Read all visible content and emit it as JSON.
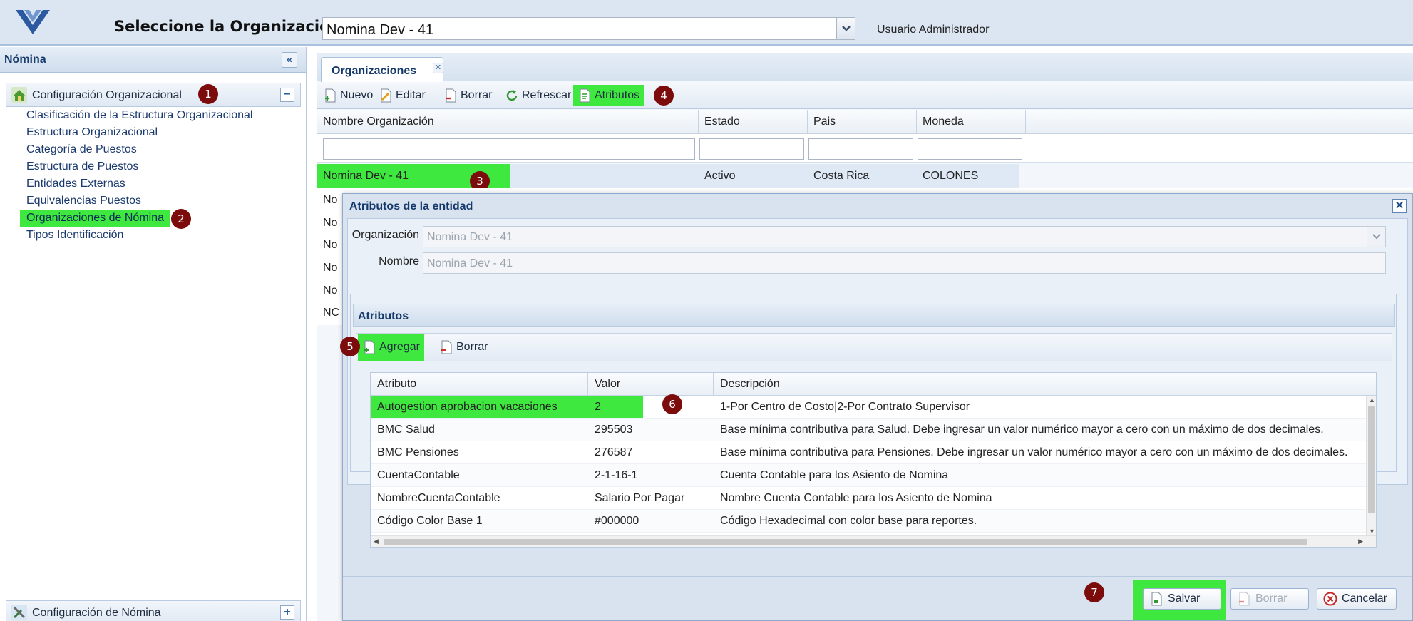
{
  "header": {
    "org_label": "Seleccione la Organización:",
    "org_value": "Nomina Dev - 41",
    "user": "Usuario Administrador"
  },
  "sidebar": {
    "title": "Nómina",
    "groups": [
      {
        "label": "Configuración Organizacional",
        "state": "−"
      },
      {
        "label": "Configuración de Nómina",
        "state": "+"
      }
    ],
    "items": [
      {
        "label": "Clasificación de la Estructura Organizacional"
      },
      {
        "label": "Estructura Organizacional"
      },
      {
        "label": "Categoría de Puestos"
      },
      {
        "label": "Estructura de Puestos"
      },
      {
        "label": "Entidades Externas"
      },
      {
        "label": "Equivalencias Puestos"
      },
      {
        "label": "Organizaciones de Nómina"
      },
      {
        "label": "Tipos Identificación"
      }
    ]
  },
  "markers": [
    "1",
    "2",
    "3",
    "4",
    "5",
    "6",
    "7"
  ],
  "tab": {
    "label": "Organizaciones"
  },
  "toolbar": {
    "nuevo": "Nuevo",
    "editar": "Editar",
    "borrar": "Borrar",
    "refrescar": "Refrescar",
    "atributos": "Atributos"
  },
  "grid": {
    "columns": [
      "Nombre Organización",
      "Estado",
      "Pais",
      "Moneda"
    ],
    "rows": [
      {
        "name": "Nomina Dev - 41",
        "estado": "Activo",
        "pais": "Costa Rica",
        "moneda": "COLONES"
      },
      {
        "name": "No"
      },
      {
        "name": "No"
      },
      {
        "name": "No"
      },
      {
        "name": "No"
      },
      {
        "name": "No"
      },
      {
        "name": "NC"
      }
    ]
  },
  "modal": {
    "title": "Atributos de la entidad",
    "organizacion_label": "Organización",
    "organizacion_value": "Nomina Dev - 41",
    "nombre_label": "Nombre",
    "nombre_value": "Nomina Dev - 41",
    "attr_panel_title": "Atributos",
    "agregar": "Agregar",
    "borrar": "Borrar",
    "attr_columns": [
      "Atributo",
      "Valor",
      "Descripción"
    ],
    "attr_rows": [
      {
        "atributo": "Autogestion aprobacion vacaciones",
        "valor": "2",
        "descripcion": "1-Por Centro de Costo|2-Por Contrato Supervisor"
      },
      {
        "atributo": "BMC Salud",
        "valor": "295503",
        "descripcion": "Base mínima contributiva para Salud. Debe ingresar un valor numérico mayor a cero con un máximo de dos decimales."
      },
      {
        "atributo": "BMC Pensiones",
        "valor": "276587",
        "descripcion": "Base mínima contributiva para Pensiones. Debe ingresar un valor numérico mayor a cero con un máximo de dos decimales."
      },
      {
        "atributo": "CuentaContable",
        "valor": "2-1-16-1",
        "descripcion": "Cuenta Contable para los Asiento de Nomina"
      },
      {
        "atributo": "NombreCuentaContable",
        "valor": "Salario Por Pagar",
        "descripcion": "Nombre Cuenta Contable para los Asiento de Nomina"
      },
      {
        "atributo": "Código Color Base 1",
        "valor": "#000000",
        "descripcion": "Código Hexadecimal con color base para reportes."
      }
    ],
    "salvar": "Salvar",
    "footer_borrar": "Borrar",
    "cancelar": "Cancelar"
  },
  "colors": {
    "highlight": "#3ee83e",
    "marker": "#7c0b0b",
    "brand": "#14396a"
  }
}
